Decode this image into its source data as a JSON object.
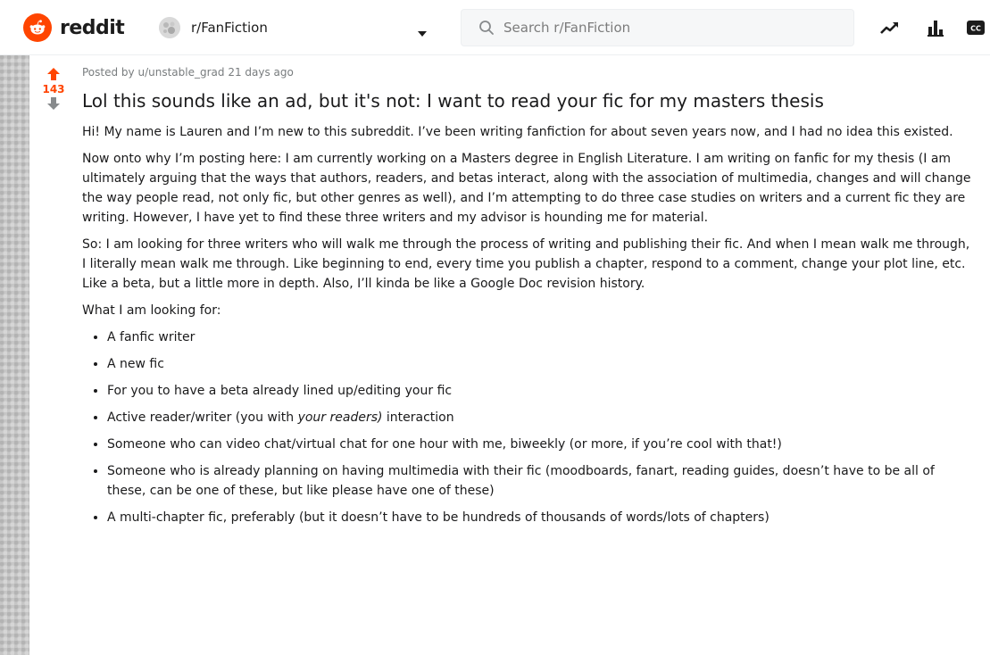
{
  "header": {
    "logo_text": "reddit",
    "community": "r/FanFiction",
    "search_placeholder": "Search r/FanFiction",
    "icons": [
      "trending-icon",
      "stats-icon",
      "closed-captions-icon"
    ],
    "brand_color": "#ff4500"
  },
  "post": {
    "posted_by_prefix": "Posted by",
    "author": "u/unstable_grad",
    "age": "21 days ago",
    "votes": "143",
    "title": "Lol this sounds like an ad, but it's not: I want to read your fic for my masters thesis",
    "paragraphs": [
      "Hi! My name is Lauren and I’m new to this subreddit. I’ve been writing fanfiction for about seven years now, and I had no idea this existed.",
      "Now onto why I’m posting here: I am currently working on a Masters degree in English Literature. I am writing on fanfic for my thesis (I am ultimately arguing that the ways that authors, readers, and betas interact, along with the association of multimedia, changes and will change the way people read, not only fic, but other genres as well), and I’m attempting to do three case studies on writers and a current fic they are writing. However, I have yet to find these three writers and my advisor is hounding me for material.",
      "So: I am looking for three writers who will walk me through the process of writing and publishing their fic. And when I mean walk me through, I literally mean walk me through. Like beginning to end, every time you publish a chapter, respond to a comment, change your plot line, etc. Like a beta, but a little more in depth. Also, I’ll kinda be like a Google Doc revision history.",
      "What I am looking for:"
    ],
    "list": [
      "A fanfic writer",
      "A new fic",
      "For you to have a beta already lined up/editing your fic",
      "Active reader/writer (you with ",
      "Someone who can video chat/virtual chat for one hour with me, biweekly (or more, if you’re cool with that!)",
      "Someone who is already planning on having multimedia with their fic (moodboards, fanart, reading guides, doesn’t have to be all of these, can be one of these, but like please have one of these)",
      "A multi-chapter fic, preferably (but it doesn’t have to be hundreds of thousands of words/lots of chapters)"
    ],
    "list_item_4_emphasis": "your readers)",
    "list_item_4_suffix": " interaction"
  }
}
